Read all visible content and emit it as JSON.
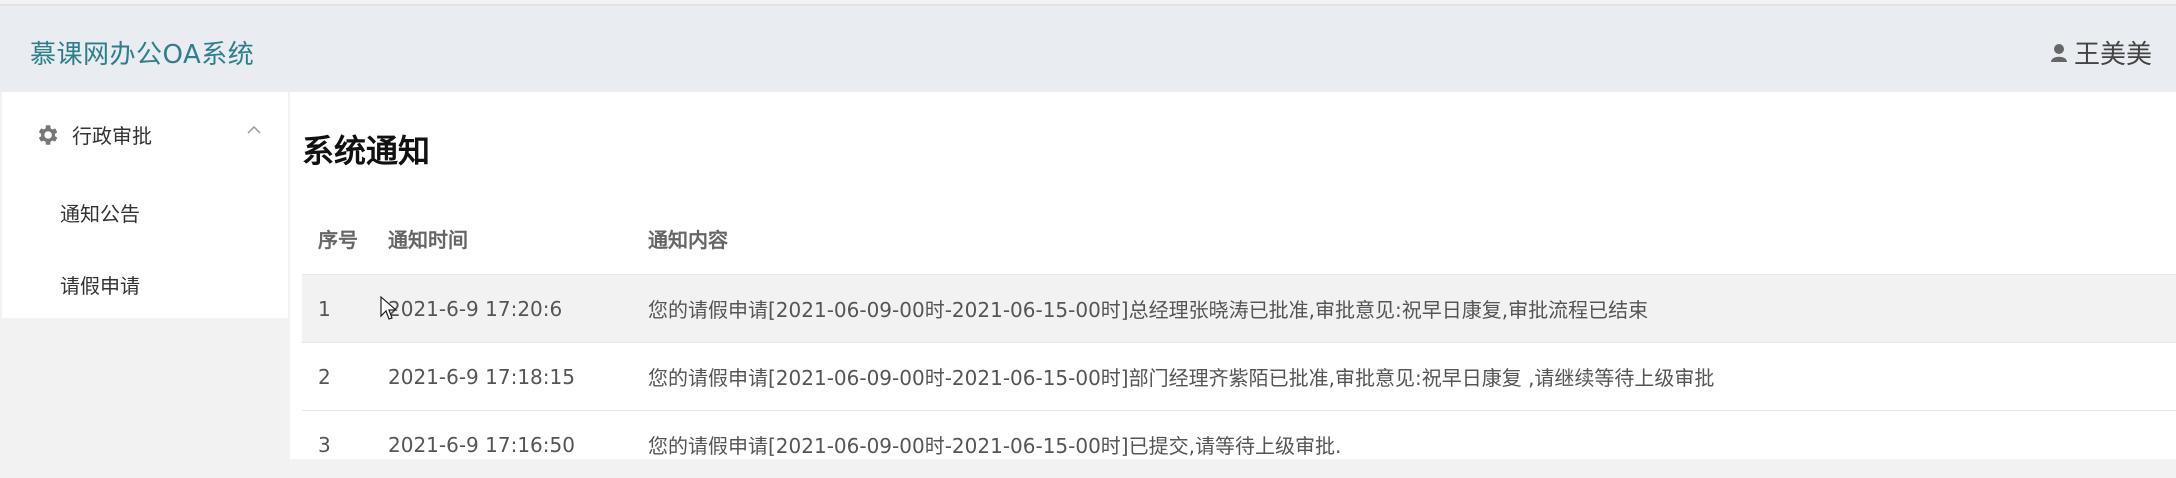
{
  "header": {
    "brand": "慕课网办公OA系统",
    "user_name": "王美美",
    "user_icon": "user-icon"
  },
  "sidebar": {
    "group": {
      "label": "行政审批",
      "icon": "gear-icon",
      "chevron": "chevron-up-icon"
    },
    "items": [
      {
        "label": "通知公告"
      },
      {
        "label": "请假申请"
      }
    ]
  },
  "main": {
    "title": "系统通知",
    "table": {
      "headers": [
        "序号",
        "通知时间",
        "通知内容"
      ],
      "rows": [
        {
          "no": "1",
          "time": "2021-6-9 17:20:6",
          "content": "您的请假申请[2021-06-09-00时-2021-06-15-00时]总经理张晓涛已批准,审批意见:祝早日康复,审批流程已结束"
        },
        {
          "no": "2",
          "time": "2021-6-9 17:18:15",
          "content": "您的请假申请[2021-06-09-00时-2021-06-15-00时]部门经理齐紫陌已批准,审批意见:祝早日康复 ,请继续等待上级审批"
        },
        {
          "no": "3",
          "time": "2021-6-9 17:16:50",
          "content": "您的请假申请[2021-06-09-00时-2021-06-15-00时]已提交,请等待上级审批."
        }
      ]
    }
  },
  "colors": {
    "brand": "#2d7f8a",
    "header_bg": "#e9ecf1",
    "row_alt": "#f2f2f2"
  }
}
